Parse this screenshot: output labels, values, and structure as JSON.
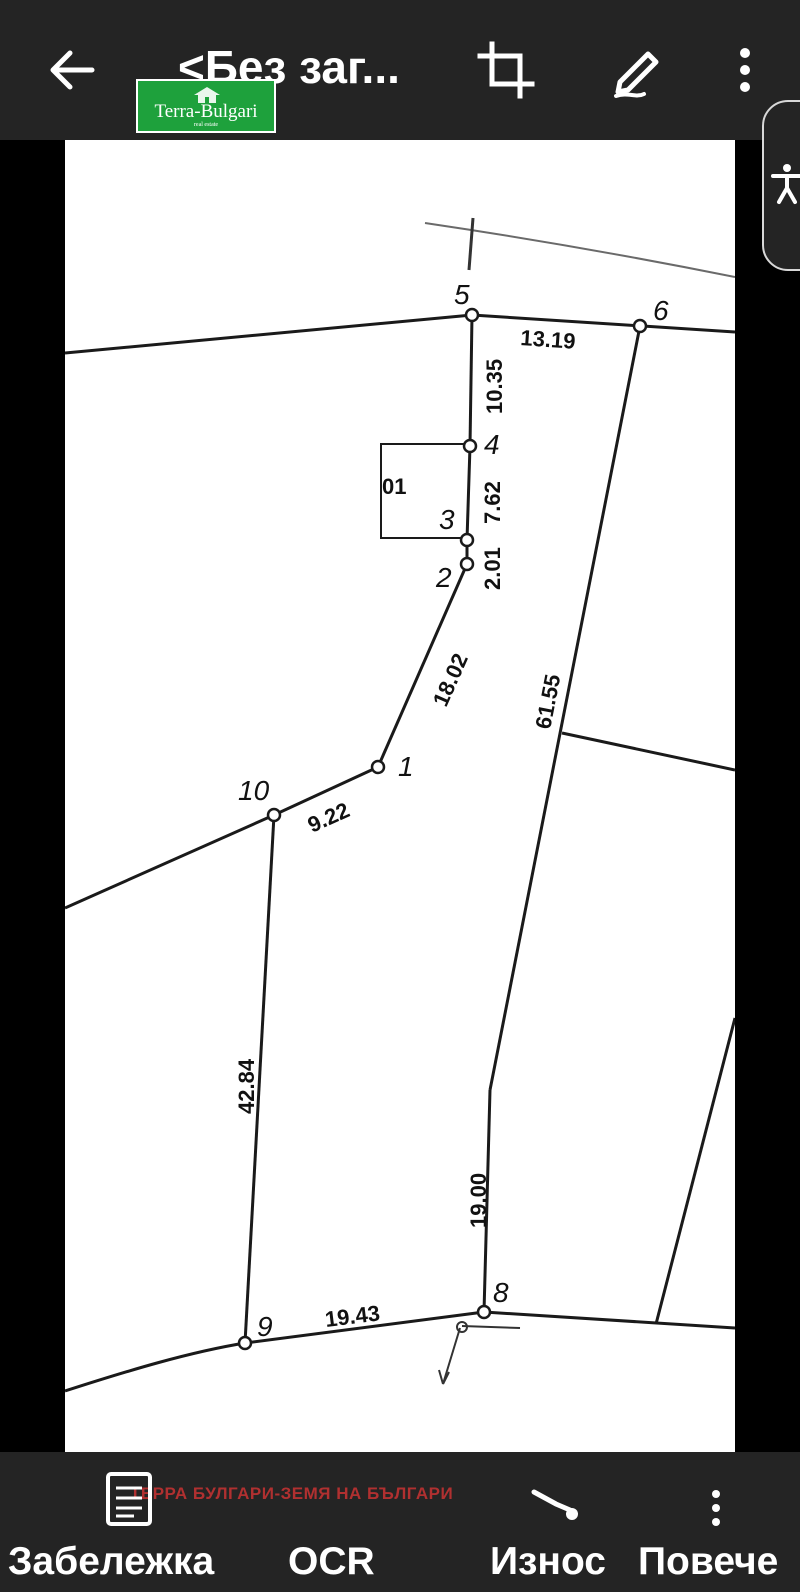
{
  "topbar": {
    "title": "<Без заг...",
    "back_icon": "arrow-left-icon",
    "crop_icon": "crop-icon",
    "edit_icon": "pencil-icon",
    "more_icon": "more-vertical-icon"
  },
  "logo": {
    "text": "Terra-Bulgari",
    "subtext": "real estate"
  },
  "accessibility": {
    "icon": "accessibility-icon"
  },
  "plan": {
    "points": [
      "1",
      "2",
      "3",
      "4",
      "5",
      "6",
      "8",
      "9",
      "10"
    ],
    "building_label": "01",
    "distances": [
      "13.19",
      "10.35",
      "7.62",
      "2.01",
      "18.02",
      "61.55",
      "9.22",
      "42.84",
      "19.00",
      "19.43"
    ]
  },
  "bottombar": {
    "note_label": "Забележка",
    "ocr_label": "OCR",
    "export_label": "Износ",
    "more_label": "Повече",
    "watermark": "ТЕРРА БУЛГАРИ-ЗЕМЯ НА БЪЛГАРИ"
  }
}
